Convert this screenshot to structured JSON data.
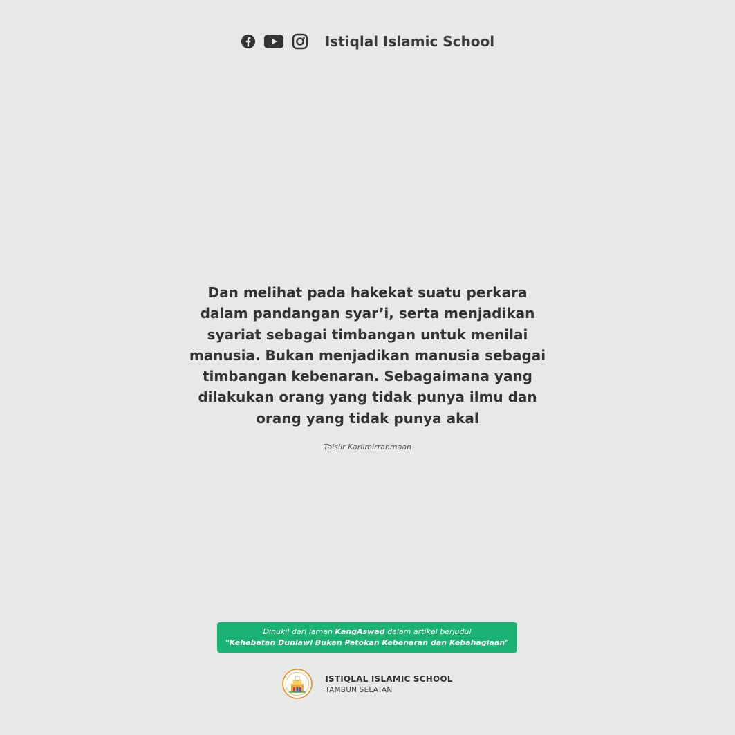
{
  "header": {
    "icons": [
      "facebook-icon",
      "youtube-icon",
      "instagram-icon"
    ],
    "brand_name": "Istiqlal Islamic School"
  },
  "quote": {
    "text": "Dan melihat pada hakekat suatu perkara dalam pandangan syar’i, serta menjadikan syariat sebagai timbangan untuk menilai manusia. Bukan menjadikan manusia sebagai timbangan kebenaran. Sebagaimana yang dilakukan orang yang tidak punya ilmu dan orang yang tidak punya akal",
    "source": "Taisiir Kariimirrahmaan"
  },
  "credit": {
    "prefix": "Dinukil dari laman",
    "site": "KangAswad",
    "middle": "dalam artikel berjudul",
    "article_title": "\"Kehebatan Duniawi Bukan Patokan Kebenaran dan Kebahagiaan\""
  },
  "footer": {
    "school_name": "ISTIQLAL ISLAMIC SCHOOL",
    "location": "TAMBUN SELATAN"
  },
  "colors": {
    "background": "#e6e9e7",
    "accent": "#1bb373",
    "text": "#333333"
  }
}
